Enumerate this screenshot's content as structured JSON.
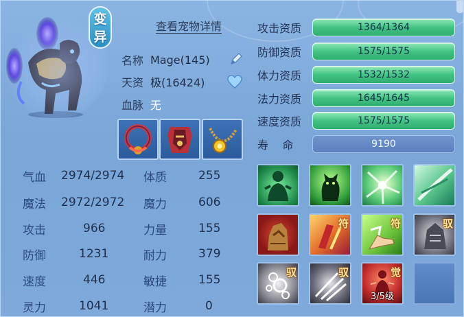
{
  "badge": {
    "line1": "变",
    "line2": "异"
  },
  "header": {
    "detail_link": "查看宠物详情"
  },
  "info": {
    "name_label": "名称",
    "name_value": "Mage(145)",
    "talent_label": "天资",
    "talent_value": "极(16424)",
    "bloodline_label": "血脉",
    "bloodline_value": "无"
  },
  "stats": [
    {
      "label": "气血",
      "value": "2974/2974"
    },
    {
      "label": "体质",
      "value": "255"
    },
    {
      "label": "魔法",
      "value": "2972/2972"
    },
    {
      "label": "魔力",
      "value": "606"
    },
    {
      "label": "攻击",
      "value": "966"
    },
    {
      "label": "力量",
      "value": "155"
    },
    {
      "label": "防御",
      "value": "1231"
    },
    {
      "label": "耐力",
      "value": "379"
    },
    {
      "label": "速度",
      "value": "446"
    },
    {
      "label": "敏捷",
      "value": "155"
    },
    {
      "label": "灵力",
      "value": "1041"
    },
    {
      "label": "潜力",
      "value": "0"
    }
  ],
  "aptitudes": [
    {
      "label": "攻击资质",
      "value": "1364/1364",
      "fill": 1.0
    },
    {
      "label": "防御资质",
      "value": "1575/1575",
      "fill": 1.0
    },
    {
      "label": "体力资质",
      "value": "1532/1532",
      "fill": 1.0
    },
    {
      "label": "法力资质",
      "value": "1645/1645",
      "fill": 1.0
    },
    {
      "label": "速度资质",
      "value": "1575/1575",
      "fill": 1.0
    }
  ],
  "lifespan": {
    "label": "寿    命",
    "value": "9190"
  },
  "skills": [
    {
      "icon": "green-spirit-skill-icon",
      "tag": ""
    },
    {
      "icon": "shadow-cat-skill-icon",
      "tag": ""
    },
    {
      "icon": "green-burst-skill-icon",
      "tag": ""
    },
    {
      "icon": "wind-slash-skill-icon",
      "tag": ""
    },
    {
      "icon": "rock-golem-skill-icon",
      "tag": ""
    },
    {
      "icon": "talisman-skill-icon",
      "tag": "符"
    },
    {
      "icon": "palm-talisman-skill-icon",
      "tag": "符"
    },
    {
      "icon": "armor-skill-icon",
      "tag": "驭"
    },
    {
      "icon": "orbs-skill-icon",
      "tag": "驭"
    },
    {
      "icon": "blades-skill-icon",
      "tag": "驭"
    },
    {
      "icon": "awaken-skill-icon",
      "tag": "觉",
      "level": "3/5级"
    }
  ],
  "colors": {
    "panel_bg": "#7aa6d8",
    "aptitude_bar": "#43c283",
    "lifespan_bar": "#5b81bd",
    "label_blue": "#2c4a80"
  }
}
